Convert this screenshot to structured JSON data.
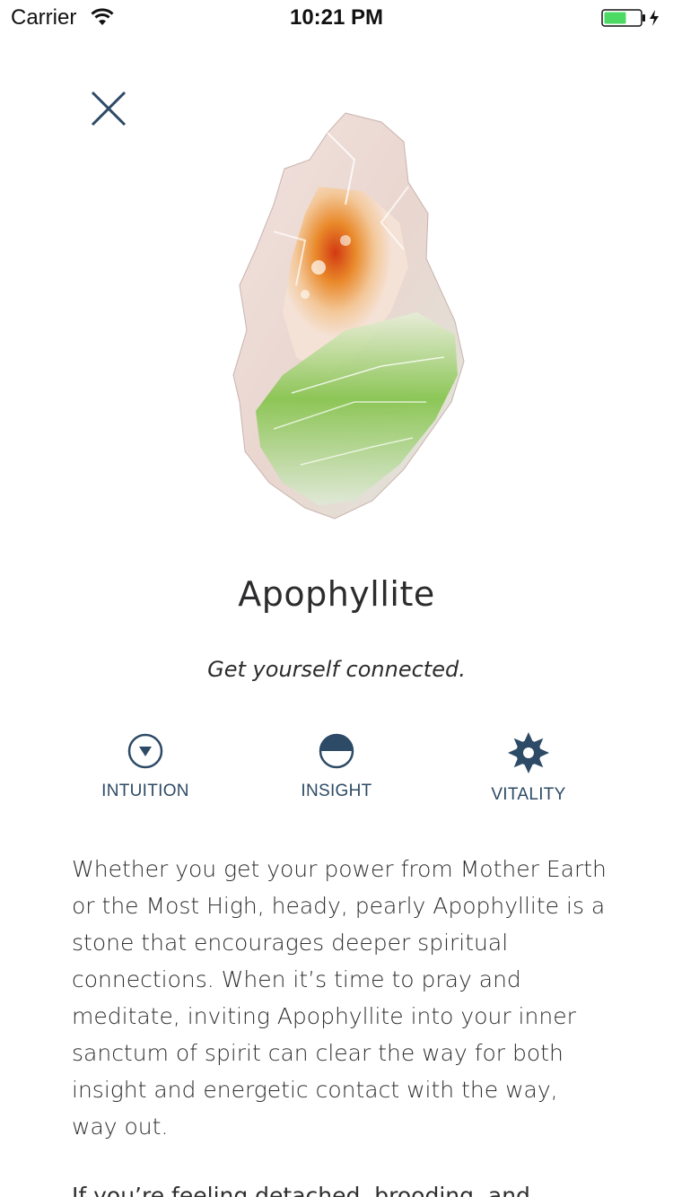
{
  "status_bar": {
    "carrier": "Carrier",
    "time": "10:21 PM",
    "battery_color": "#4cd964"
  },
  "close_icon": "close-icon",
  "stone": {
    "name": "Apophyllite",
    "tagline": "Get yourself connected.",
    "colors": {
      "accent": "#2d4a66"
    }
  },
  "attributes": [
    {
      "label": "INTUITION",
      "icon": "circle-triangle-down-icon"
    },
    {
      "label": "INSIGHT",
      "icon": "half-filled-circle-icon"
    },
    {
      "label": "VITALITY",
      "icon": "sun-gear-icon"
    }
  ],
  "description": {
    "paragraph_1": "Whether you get your power from Mother Earth or the Most High, heady, pearly Apophyllite is a stone that encourages deeper spiritual connections. When it’s time to pray and meditate, inviting Apophyllite into your inner sanctum of spirit can clear the way for both insight and energetic contact with the way, way out.",
    "paragraph_2": "If you’re feeling detached, brooding, and"
  }
}
